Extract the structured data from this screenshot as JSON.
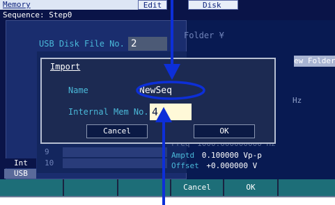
{
  "header": {
    "title": "Memory",
    "tab_edit": "Edit",
    "tab_disk": "Disk"
  },
  "sequence": "Sequence: Step0",
  "usb_file": {
    "label": "USB Disk File No.",
    "value": "2"
  },
  "folder_label": "Folder ¥",
  "new_folder": "ew Folder",
  "list_numbers": [
    "9",
    "10"
  ],
  "left_tabs": {
    "int": "Int",
    "usb": "USB"
  },
  "info": {
    "freq_label": "Freq",
    "freq_value": "1000.000000000 Hz",
    "amptd_label": "Amptd",
    "amptd_value": "0.100000 Vp-p",
    "offset_label": "Offset",
    "offset_value": "+0.000000 V",
    "hz_top": "Hz"
  },
  "dialog": {
    "title": "Import",
    "name_label": "Name",
    "name_value": "NewSeq",
    "mem_label": "Internal Mem No.",
    "mem_value": "4",
    "cancel": "Cancel",
    "ok": "OK"
  },
  "softkeys": {
    "cancel": "Cancel",
    "ok": "OK"
  },
  "colors": {
    "screen_bg": "#081a52",
    "dialog_bg": "#1c2a52",
    "softkey": "#1d6e78",
    "annotation": "#0d2fd8",
    "label_cyan": "#4ab8d8"
  }
}
